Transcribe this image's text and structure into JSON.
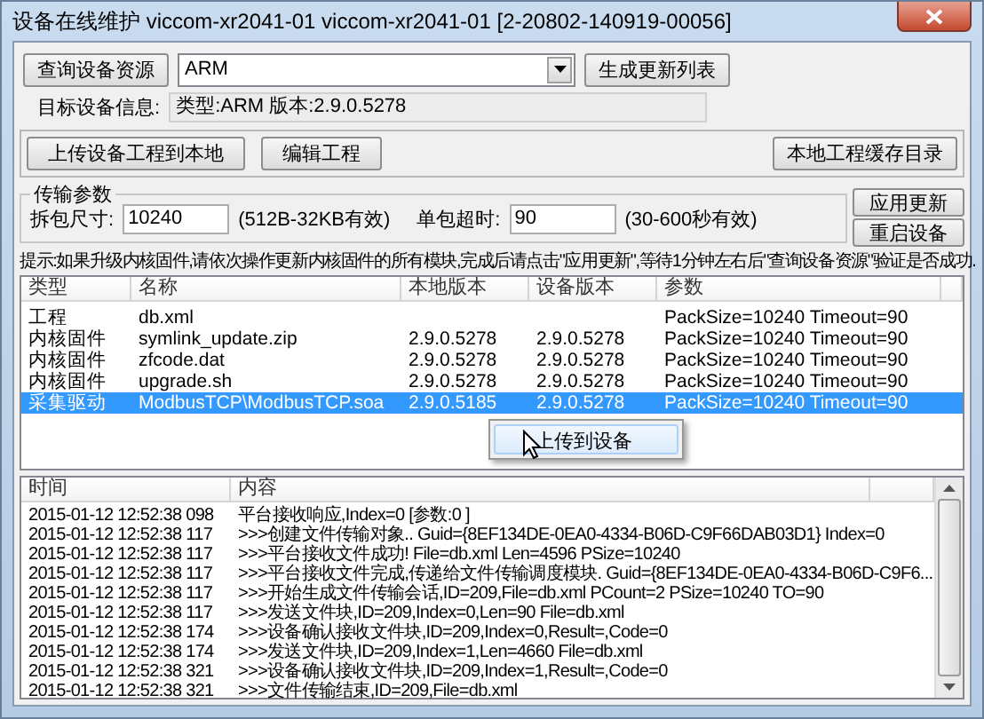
{
  "window": {
    "title": "设备在线维护 viccom-xr2041-01 viccom-xr2041-01 [2-20802-140919-00056]"
  },
  "toolbar": {
    "query_button": "查询设备资源",
    "device_type": {
      "value": "ARM"
    },
    "generate_button": "生成更新列表"
  },
  "target_info": {
    "label": "目标设备信息:",
    "value": "类型:ARM 版本:2.9.0.5278"
  },
  "project_bar": {
    "buttons": [
      "上传设备工程到本地",
      "编辑工程"
    ],
    "cache_button": "本地工程缓存目录"
  },
  "transfer_params": {
    "title": "传输参数",
    "split_size": {
      "label": "拆包尺寸:",
      "value": "10240",
      "hint": "(512B-32KB有效)"
    },
    "timeout": {
      "label": "单包超时:",
      "value": "90",
      "hint": "(30-600秒有效)"
    }
  },
  "action_buttons": [
    "应用更新",
    "重启设备"
  ],
  "hint": "提示:如果升级内核固件,请依次操作更新内核固件的所有模块,完成后请点击\"应用更新\",等待1分钟左右后\"查询设备资源\"验证是否成功.",
  "file_table": {
    "columns": [
      "类型",
      "名称",
      "本地版本",
      "设备版本",
      "参数"
    ],
    "rows": [
      {
        "cells": [
          "工程",
          "db.xml",
          "",
          "",
          "PackSize=10240 Timeout=90"
        ],
        "selected": false
      },
      {
        "cells": [
          "内核固件",
          "symlink_update.zip",
          "2.9.0.5278",
          "2.9.0.5278",
          "PackSize=10240 Timeout=90"
        ],
        "selected": false
      },
      {
        "cells": [
          "内核固件",
          "zfcode.dat",
          "2.9.0.5278",
          "2.9.0.5278",
          "PackSize=10240 Timeout=90"
        ],
        "selected": false
      },
      {
        "cells": [
          "内核固件",
          "upgrade.sh",
          "2.9.0.5278",
          "2.9.0.5278",
          "PackSize=10240 Timeout=90"
        ],
        "selected": false
      },
      {
        "cells": [
          "采集驱动",
          "ModbusTCP\\ModbusTCP.soa",
          "2.9.0.5185",
          "2.9.0.5278",
          "PackSize=10240 Timeout=90"
        ],
        "selected": true
      }
    ]
  },
  "context_menu": {
    "items": [
      "上传到设备"
    ]
  },
  "log_table": {
    "columns": [
      "时间",
      "内容"
    ],
    "rows": [
      {
        "time": "2015-01-12 12:52:38 098",
        "content": "平台接收响应,Index=0 [参数:0 ]"
      },
      {
        "time": "2015-01-12 12:52:38 117",
        "content": ">>>创建文件传输对象.. Guid={8EF134DE-0EA0-4334-B06D-C9F66DAB03D1} Index=0"
      },
      {
        "time": "2015-01-12 12:52:38 117",
        "content": ">>>平台接收文件成功! File=db.xml Len=4596 PSize=10240"
      },
      {
        "time": "2015-01-12 12:52:38 117",
        "content": ">>>平台接收文件完成,传递给文件传输调度模块. Guid={8EF134DE-0EA0-4334-B06D-C9F6..."
      },
      {
        "time": "2015-01-12 12:52:38 117",
        "content": ">>>开始生成文件传输会话,ID=209,File=db.xml PCount=2 PSize=10240 TO=90"
      },
      {
        "time": "2015-01-12 12:52:38 117",
        "content": ">>>发送文件块,ID=209,Index=0,Len=90 File=db.xml"
      },
      {
        "time": "2015-01-12 12:52:38 174",
        "content": ">>>设备确认接收文件块,ID=209,Index=0,Result=,Code=0"
      },
      {
        "time": "2015-01-12 12:52:38 174",
        "content": ">>>发送文件块,ID=209,Index=1,Len=4660 File=db.xml"
      },
      {
        "time": "2015-01-12 12:52:38 321",
        "content": ">>>设备确认接收文件块,ID=209,Index=1,Result=,Code=0"
      },
      {
        "time": "2015-01-12 12:52:38 321",
        "content": ">>>文件传输结束,ID=209,File=db.xml"
      }
    ]
  }
}
